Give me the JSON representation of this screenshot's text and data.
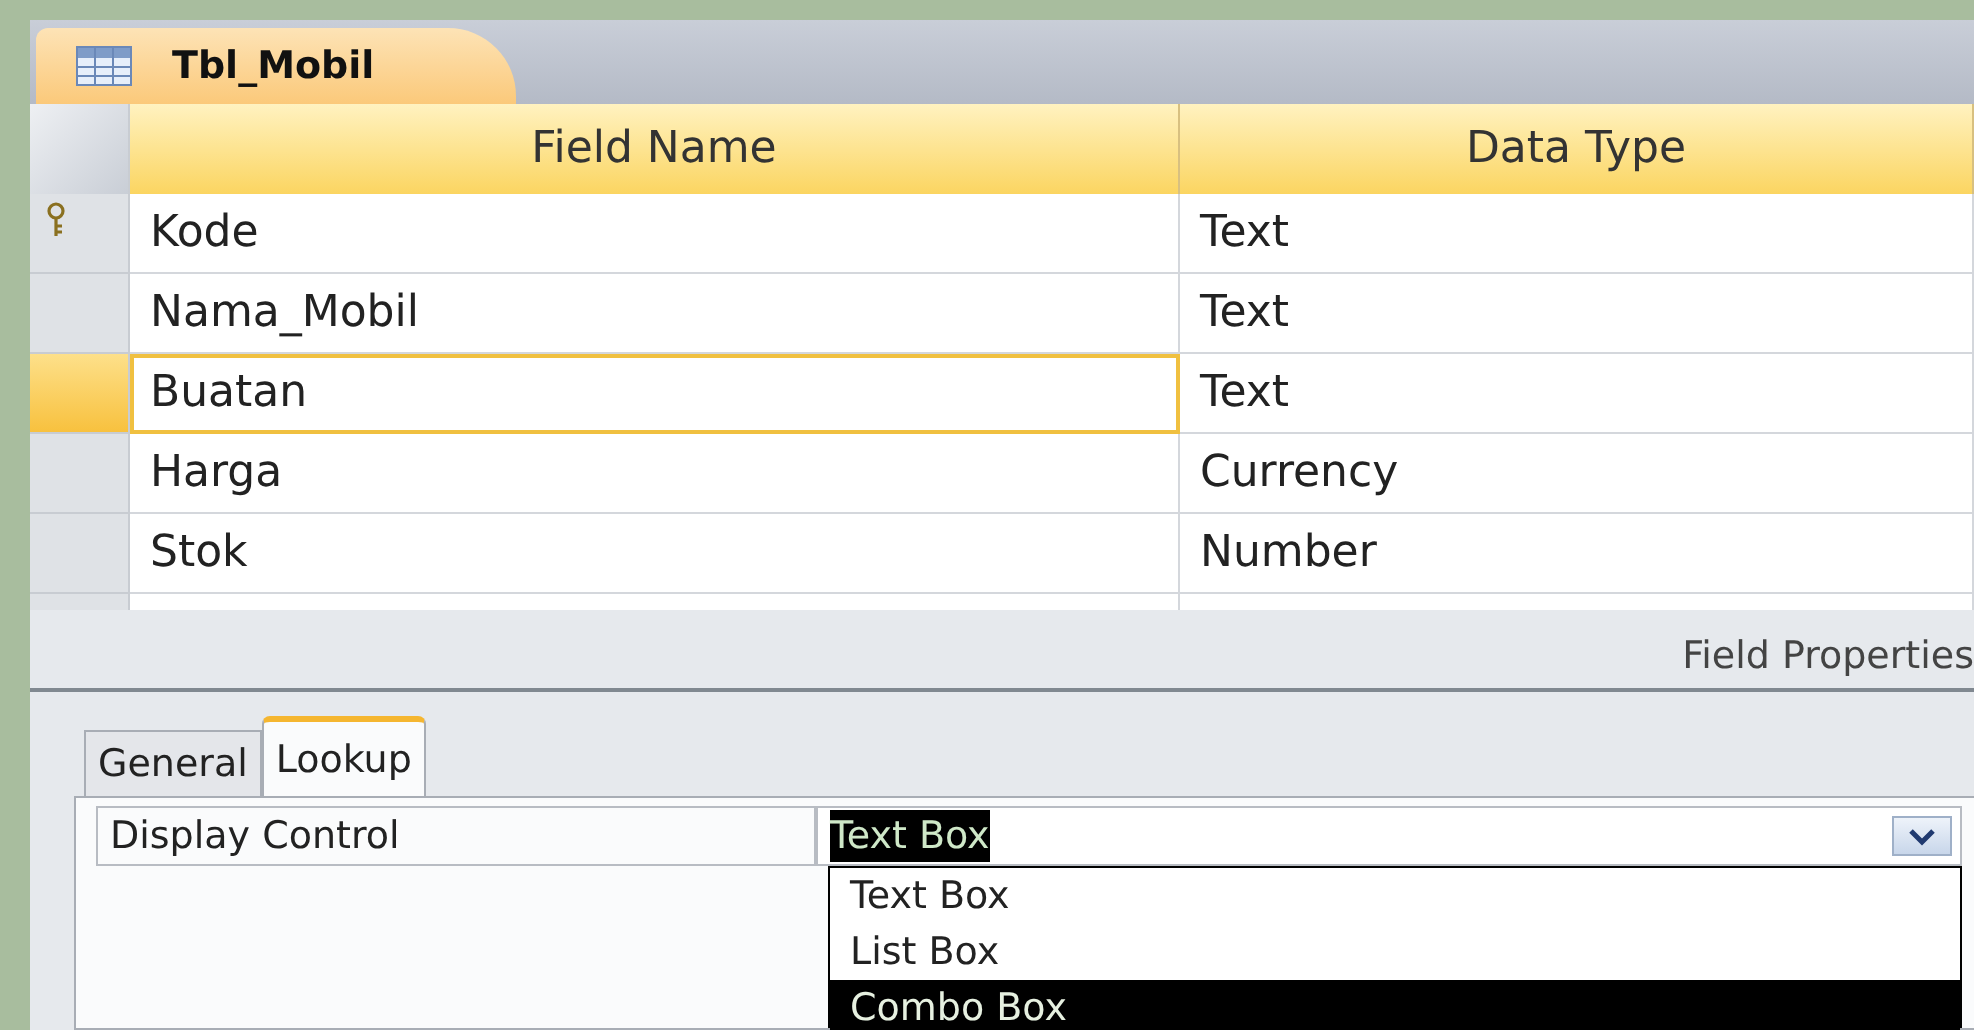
{
  "document_tab": {
    "title": "Tbl_Mobil"
  },
  "columns": [
    "Field Name",
    "Data Type"
  ],
  "rows": [
    {
      "field_name": "Kode",
      "data_type": "Text",
      "primary_key": true,
      "selected": false
    },
    {
      "field_name": "Nama_Mobil",
      "data_type": "Text",
      "primary_key": false,
      "selected": false
    },
    {
      "field_name": "Buatan",
      "data_type": "Text",
      "primary_key": false,
      "selected": true
    },
    {
      "field_name": "Harga",
      "data_type": "Currency",
      "primary_key": false,
      "selected": false
    },
    {
      "field_name": "Stok",
      "data_type": "Number",
      "primary_key": false,
      "selected": false
    }
  ],
  "field_properties": {
    "title": "Field Properties",
    "tabs": [
      {
        "label": "General",
        "selected": false
      },
      {
        "label": "Lookup",
        "selected": true
      }
    ],
    "properties": [
      {
        "label": "Display Control",
        "value": "Text Box"
      }
    ],
    "dropdown_options": [
      {
        "label": "Text Box",
        "selected": false
      },
      {
        "label": "List Box",
        "selected": false
      },
      {
        "label": "Combo Box",
        "selected": true
      }
    ]
  }
}
